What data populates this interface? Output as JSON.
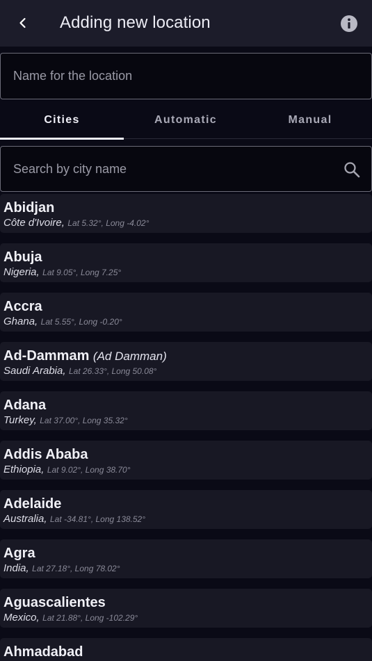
{
  "header": {
    "title": "Adding new location"
  },
  "name_field": {
    "placeholder": "Name for the location",
    "value": ""
  },
  "tabs": [
    {
      "label": "Cities",
      "active": true
    },
    {
      "label": "Automatic",
      "active": false
    },
    {
      "label": "Manual",
      "active": false
    }
  ],
  "search": {
    "placeholder": "Search by city name",
    "value": ""
  },
  "cities": [
    {
      "name": "Abidjan",
      "alt": "",
      "country": "Côte d'Ivoire,",
      "coords": "Lat 5.32°, Long -4.02°"
    },
    {
      "name": "Abuja",
      "alt": "",
      "country": "Nigeria,",
      "coords": "Lat 9.05°, Long 7.25°"
    },
    {
      "name": "Accra",
      "alt": "",
      "country": "Ghana,",
      "coords": "Lat 5.55°, Long -0.20°"
    },
    {
      "name": "Ad-Dammam",
      "alt": "(Ad Damman)",
      "country": "Saudi Arabia,",
      "coords": "Lat 26.33°, Long 50.08°"
    },
    {
      "name": "Adana",
      "alt": "",
      "country": "Turkey,",
      "coords": "Lat 37.00°, Long 35.32°"
    },
    {
      "name": "Addis Ababa",
      "alt": "",
      "country": "Ethiopia,",
      "coords": "Lat 9.02°, Long 38.70°"
    },
    {
      "name": "Adelaide",
      "alt": "",
      "country": "Australia,",
      "coords": "Lat -34.81°, Long 138.52°"
    },
    {
      "name": "Agra",
      "alt": "",
      "country": "India,",
      "coords": "Lat 27.18°, Long 78.02°"
    },
    {
      "name": "Aguascalientes",
      "alt": "",
      "country": "Mexico,",
      "coords": "Lat 21.88°, Long -102.29°"
    },
    {
      "name": "Ahmadabad",
      "alt": "",
      "country": "",
      "coords": ""
    }
  ],
  "colors": {
    "background": "#0a0a16",
    "appbar": "#1c1c2a",
    "card": "#181824",
    "accent": "#eef0fa"
  },
  "icons": {
    "back": "chevron-left-icon",
    "info": "info-icon",
    "search": "search-icon"
  }
}
